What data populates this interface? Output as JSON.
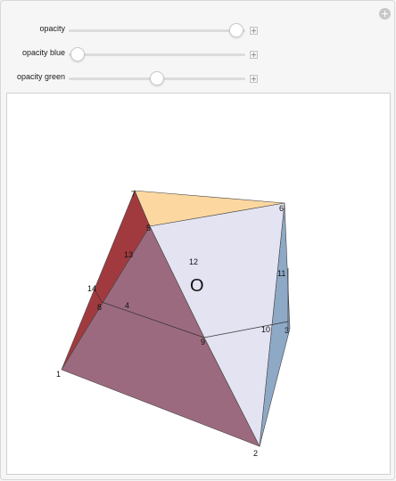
{
  "controls": [
    {
      "label": "opacity",
      "value": 0.95
    },
    {
      "label": "opacity blue",
      "value": 0.05
    },
    {
      "label": "opacity green",
      "value": 0.5
    }
  ],
  "plot": {
    "center_label": "O",
    "vertex_labels": [
      "1",
      "2",
      "3",
      "4",
      "5",
      "6",
      "7",
      "8",
      "9",
      "10",
      "11",
      "12",
      "13",
      "14"
    ]
  },
  "colors": {
    "red_face": "#a13a3f",
    "mauve_face": "#9c6a7e",
    "lavender_face": "#e4e3f2",
    "blue_face": "#8ea9c6",
    "peach_face": "#fcd8a0"
  }
}
